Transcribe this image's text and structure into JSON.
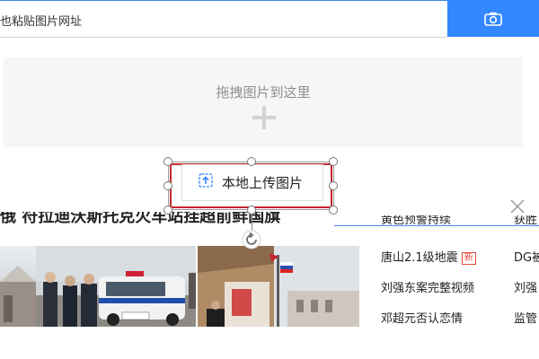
{
  "search": {
    "placeholder_visible": "也粘贴图片网址"
  },
  "camera": {
    "icon": "camera-icon"
  },
  "drop_zone": {
    "text": "拖拽图片到这里",
    "icon": "plus-icon"
  },
  "upload": {
    "label": "本地上传图片",
    "icon": "upload-icon"
  },
  "close": {
    "icon": "close-icon"
  },
  "headline": {
    "text": "俄 符拉迪沃斯托克火车站挂超前鲜国旗"
  },
  "news_col1": [
    {
      "text": "黄色预警持续"
    },
    {
      "text": "唐山2.1级地震",
      "badge": "新"
    },
    {
      "text": "刘强东案完整视频"
    },
    {
      "text": "邓超元否认恋情"
    }
  ],
  "news_col2": [
    {
      "text": "获胜"
    },
    {
      "text": "DG被"
    },
    {
      "text": "刘强"
    },
    {
      "text": "监管"
    }
  ],
  "colors": {
    "accent_blue": "#3388ff",
    "selection_red": "#c4262e",
    "badge_red": "#e34a3c"
  }
}
